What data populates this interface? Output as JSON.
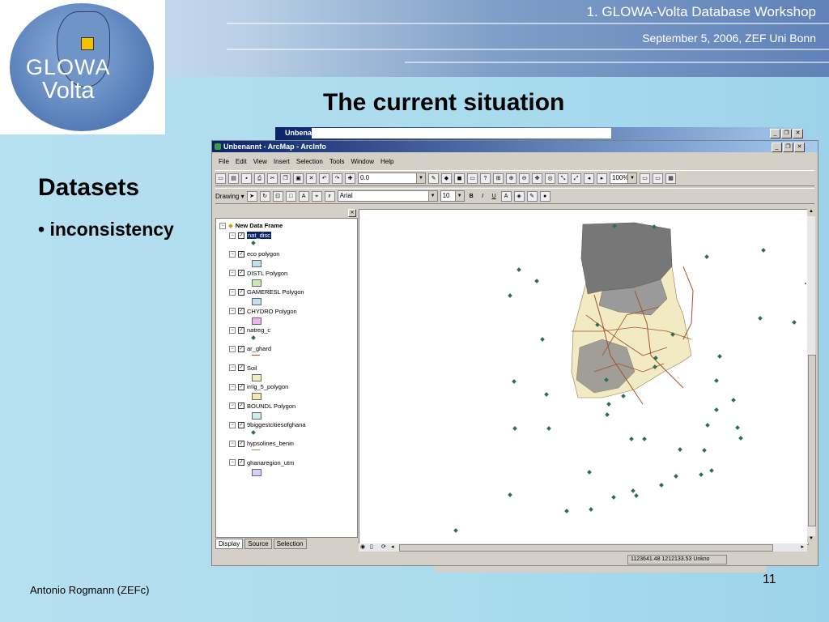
{
  "banner": {
    "title": "1. GLOWA-Volta Database Workshop",
    "date": "September 5, 2006, ZEF Uni Bonn"
  },
  "logo": {
    "line1": "GLOWA",
    "line2": "Volta"
  },
  "slide": {
    "heading": "The current situation",
    "section": "Datasets",
    "bullet": "• inconsistency",
    "author": "Antonio Rogmann (ZEFc)",
    "page": "11"
  },
  "bg_window": {
    "title": "Unbenan"
  },
  "arcmap": {
    "title": "Unbenannt - ArcMap - ArcInfo",
    "menus": [
      "File",
      "Edit",
      "View",
      "Insert",
      "Selection",
      "Tools",
      "Window",
      "Help"
    ],
    "scale_value": "0.0",
    "zoom_value": "100%",
    "drawing_label": "Drawing ▾",
    "font_name": "Arial",
    "font_size": "10",
    "bold": "B",
    "italic": "I",
    "underline": "U",
    "data_frame": "New Data Frame",
    "layers": [
      {
        "name": "nat_disc",
        "swatch": "point",
        "color": "#2a6e5a",
        "selected": true
      },
      {
        "name": "eco polygon",
        "swatch": "fill",
        "color": "#bfe0f0"
      },
      {
        "name": "DISTL Polygon",
        "swatch": "fill",
        "color": "#c6ecb4"
      },
      {
        "name": "GAMERESL Polygon",
        "swatch": "fill",
        "color": "#bfe0f0"
      },
      {
        "name": "CHYDRO Polygon",
        "swatch": "fill",
        "color": "#f0b4e8"
      },
      {
        "name": "natreg_c",
        "swatch": "point",
        "color": "#2a6e5a"
      },
      {
        "name": "ar_ghard",
        "swatch": "line",
        "color": "#a0522d"
      },
      {
        "name": "Soil",
        "swatch": "fill",
        "color": "#f5ecc0"
      },
      {
        "name": "irrig_5_polygon",
        "swatch": "fill",
        "color": "#f5e8b0"
      },
      {
        "name": "BOUNDL Polygon",
        "swatch": "fill",
        "color": "#c8ecf4"
      },
      {
        "name": "9biggestcitiesofghana",
        "swatch": "point",
        "color": "#2a6e5a"
      },
      {
        "name": "hypsolines_benin",
        "swatch": "line",
        "color": "#b08050"
      },
      {
        "name": "ghanaregion_utm",
        "swatch": "fill",
        "color": "#d8d0f8"
      }
    ],
    "tabs": [
      "Display",
      "Source",
      "Selection"
    ],
    "status_coords": "1123641.48  1212133.53 Unkno"
  }
}
